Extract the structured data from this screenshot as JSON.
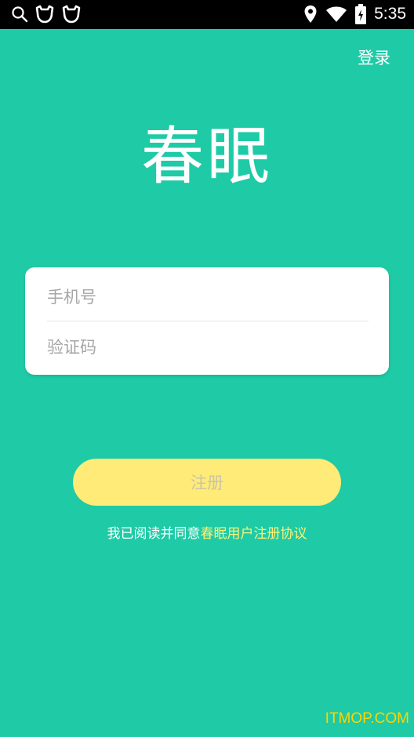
{
  "status_bar": {
    "time": "5:35",
    "icons_left": [
      "search-icon",
      "cat-face-icon",
      "cat-face-icon"
    ],
    "icons_right": [
      "location-pin-icon",
      "wifi-icon",
      "battery-icon"
    ]
  },
  "header": {
    "login_label": "登录"
  },
  "logo": {
    "text": "春眠"
  },
  "form": {
    "phone_placeholder": "手机号",
    "code_placeholder": "验证码"
  },
  "register": {
    "label": "注册"
  },
  "agreement": {
    "prefix": "我已阅读并同意",
    "link": "春眠用户注册协议"
  },
  "watermark": {
    "text": "ITMOP.COM"
  },
  "colors": {
    "background": "#1ecba6",
    "button": "#ffeb78",
    "link": "#fff176",
    "watermark": "#ffd400"
  }
}
